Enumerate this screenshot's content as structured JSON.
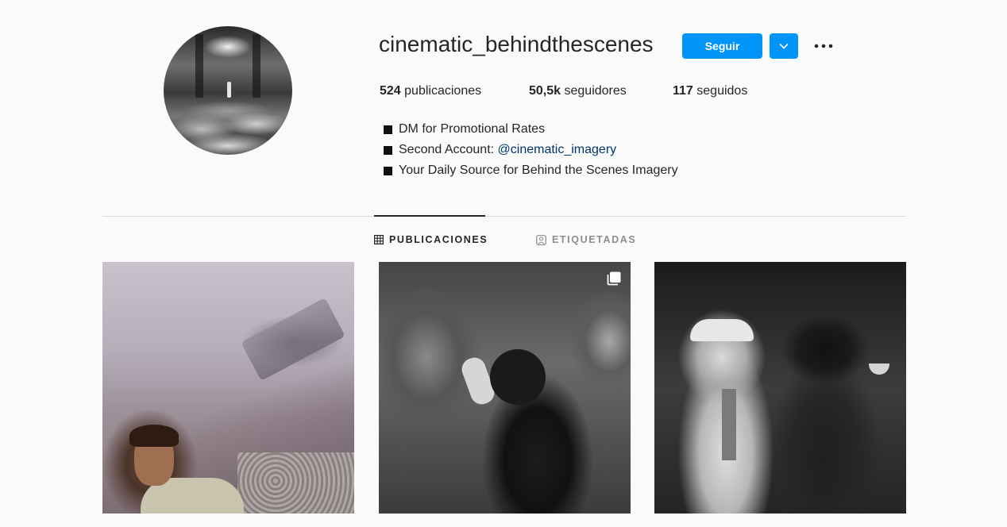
{
  "profile": {
    "username": "cinematic_behindthescenes",
    "follow_label": "Seguir",
    "stats": {
      "posts_count": "524",
      "posts_label": "publicaciones",
      "followers_count": "50,5k",
      "followers_label": "seguidores",
      "following_count": "117",
      "following_label": "seguidos"
    },
    "bio": {
      "line1": "DM for Promotional Rates",
      "line2_prefix": "Second Account: ",
      "line2_mention": "@cinematic_imagery",
      "line3": "Your Daily Source for Behind the Scenes Imagery"
    }
  },
  "tabs": {
    "posts": "PUBLICACIONES",
    "tagged": "ETIQUETADAS"
  },
  "icons": {
    "dropdown": "chevron-down-icon",
    "more": "more-options-icon",
    "posts_tab": "grid-icon",
    "tagged_tab": "tagged-person-icon",
    "multi_post": "carousel-icon"
  },
  "colors": {
    "accent": "#0095f6",
    "text": "#262626",
    "muted": "#8e8e8e",
    "link": "#00376b",
    "background": "#fafafa"
  }
}
